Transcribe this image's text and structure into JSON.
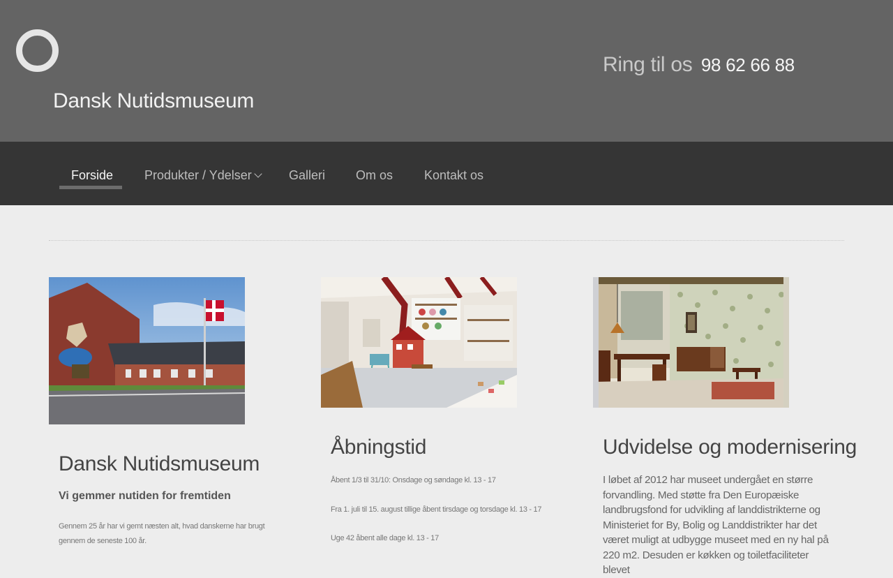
{
  "header": {
    "logo_icon": "ring-logo-icon",
    "site_title": "Dansk Nutidsmuseum",
    "phone_label": "Ring til os",
    "phone_number": "98 62 66 88"
  },
  "nav": {
    "items": [
      {
        "label": "Forside",
        "active": true
      },
      {
        "label": "Produkter / Ydelser",
        "has_dropdown": true
      },
      {
        "label": "Galleri"
      },
      {
        "label": "Om os"
      },
      {
        "label": "Kontakt os"
      }
    ]
  },
  "columns": [
    {
      "title": "Dansk Nutidsmuseum",
      "subtitle": "Vi gemmer nutiden for fremtiden",
      "text": "Gennem 25 år har vi gemt næsten alt, hvad danskerne har brugt gennem de seneste 100 år."
    },
    {
      "title": "Åbningstid",
      "lines": [
        "Åbent 1/3 til 31/10: Onsdage og søndage kl. 13 - 17",
        "Fra 1. juli til 15. august tillige åbent tirsdage og torsdage kl. 13 - 17",
        "Uge 42 åbent alle dage kl. 13 - 17"
      ]
    },
    {
      "title": "Udvidelse og modernisering",
      "text": "I løbet af 2012 har museet undergået en større forvandling. Med støtte fra Den Europæiske landbrugsfond for udvikling af landdistrikterne og Ministeriet for By, Bolig og Landdistrikter har det været muligt at udbygge museet med en ny hal på 220 m2. Desuden er køkken og toiletfaciliteter blevet"
    }
  ],
  "colors": {
    "header_bg": "#646464",
    "nav_bg": "#353535",
    "page_bg": "#ededed",
    "building_red": "#8a3a2e",
    "flag_red": "#c8102e"
  }
}
